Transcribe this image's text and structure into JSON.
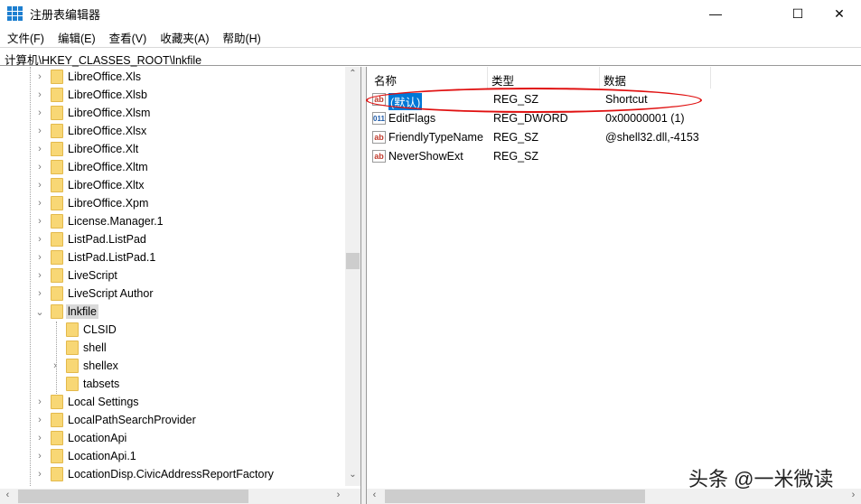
{
  "window": {
    "title": "注册表编辑器",
    "minimize": "—",
    "maximize": "☐",
    "close": "✕"
  },
  "menu": [
    "文件(F)",
    "编辑(E)",
    "查看(V)",
    "收藏夹(A)",
    "帮助(H)"
  ],
  "address": "计算机\\HKEY_CLASSES_ROOT\\lnkfile",
  "tree": [
    {
      "label": "LibreOffice.Xls",
      "level": 0,
      "expander": "›"
    },
    {
      "label": "LibreOffice.Xlsb",
      "level": 0,
      "expander": "›"
    },
    {
      "label": "LibreOffice.Xlsm",
      "level": 0,
      "expander": "›"
    },
    {
      "label": "LibreOffice.Xlsx",
      "level": 0,
      "expander": "›"
    },
    {
      "label": "LibreOffice.Xlt",
      "level": 0,
      "expander": "›"
    },
    {
      "label": "LibreOffice.Xltm",
      "level": 0,
      "expander": "›"
    },
    {
      "label": "LibreOffice.Xltx",
      "level": 0,
      "expander": "›"
    },
    {
      "label": "LibreOffice.Xpm",
      "level": 0,
      "expander": "›"
    },
    {
      "label": "License.Manager.1",
      "level": 0,
      "expander": "›"
    },
    {
      "label": "ListPad.ListPad",
      "level": 0,
      "expander": "›"
    },
    {
      "label": "ListPad.ListPad.1",
      "level": 0,
      "expander": "›"
    },
    {
      "label": "LiveScript",
      "level": 0,
      "expander": "›"
    },
    {
      "label": "LiveScript Author",
      "level": 0,
      "expander": "›"
    },
    {
      "label": "lnkfile",
      "level": 0,
      "expander": "⌄",
      "selected": true
    },
    {
      "label": "CLSID",
      "level": 1,
      "expander": ""
    },
    {
      "label": "shell",
      "level": 1,
      "expander": ""
    },
    {
      "label": "shellex",
      "level": 1,
      "expander": "›"
    },
    {
      "label": "tabsets",
      "level": 1,
      "expander": ""
    },
    {
      "label": "Local Settings",
      "level": 0,
      "expander": "›"
    },
    {
      "label": "LocalPathSearchProvider",
      "level": 0,
      "expander": "›"
    },
    {
      "label": "LocationApi",
      "level": 0,
      "expander": "›"
    },
    {
      "label": "LocationApi.1",
      "level": 0,
      "expander": "›"
    },
    {
      "label": "LocationDisp.CivicAddressReportFactory",
      "level": 0,
      "expander": "›"
    }
  ],
  "columns": {
    "name": "名称",
    "type": "类型",
    "data": "数据"
  },
  "values": [
    {
      "icon": "ab",
      "name": "(默认)",
      "type": "REG_SZ",
      "data": "Shortcut",
      "selected": true
    },
    {
      "icon": "011",
      "name": "EditFlags",
      "type": "REG_DWORD",
      "data": "0x00000001 (1)"
    },
    {
      "icon": "ab",
      "name": "FriendlyTypeName",
      "type": "REG_SZ",
      "data": "@shell32.dll,-4153"
    },
    {
      "icon": "ab",
      "name": "NeverShowExt",
      "type": "REG_SZ",
      "data": ""
    }
  ],
  "scroll": {
    "left": "‹",
    "right": "›",
    "down": "⌄",
    "up": "⌃"
  },
  "watermark": "头条 @一米微读"
}
